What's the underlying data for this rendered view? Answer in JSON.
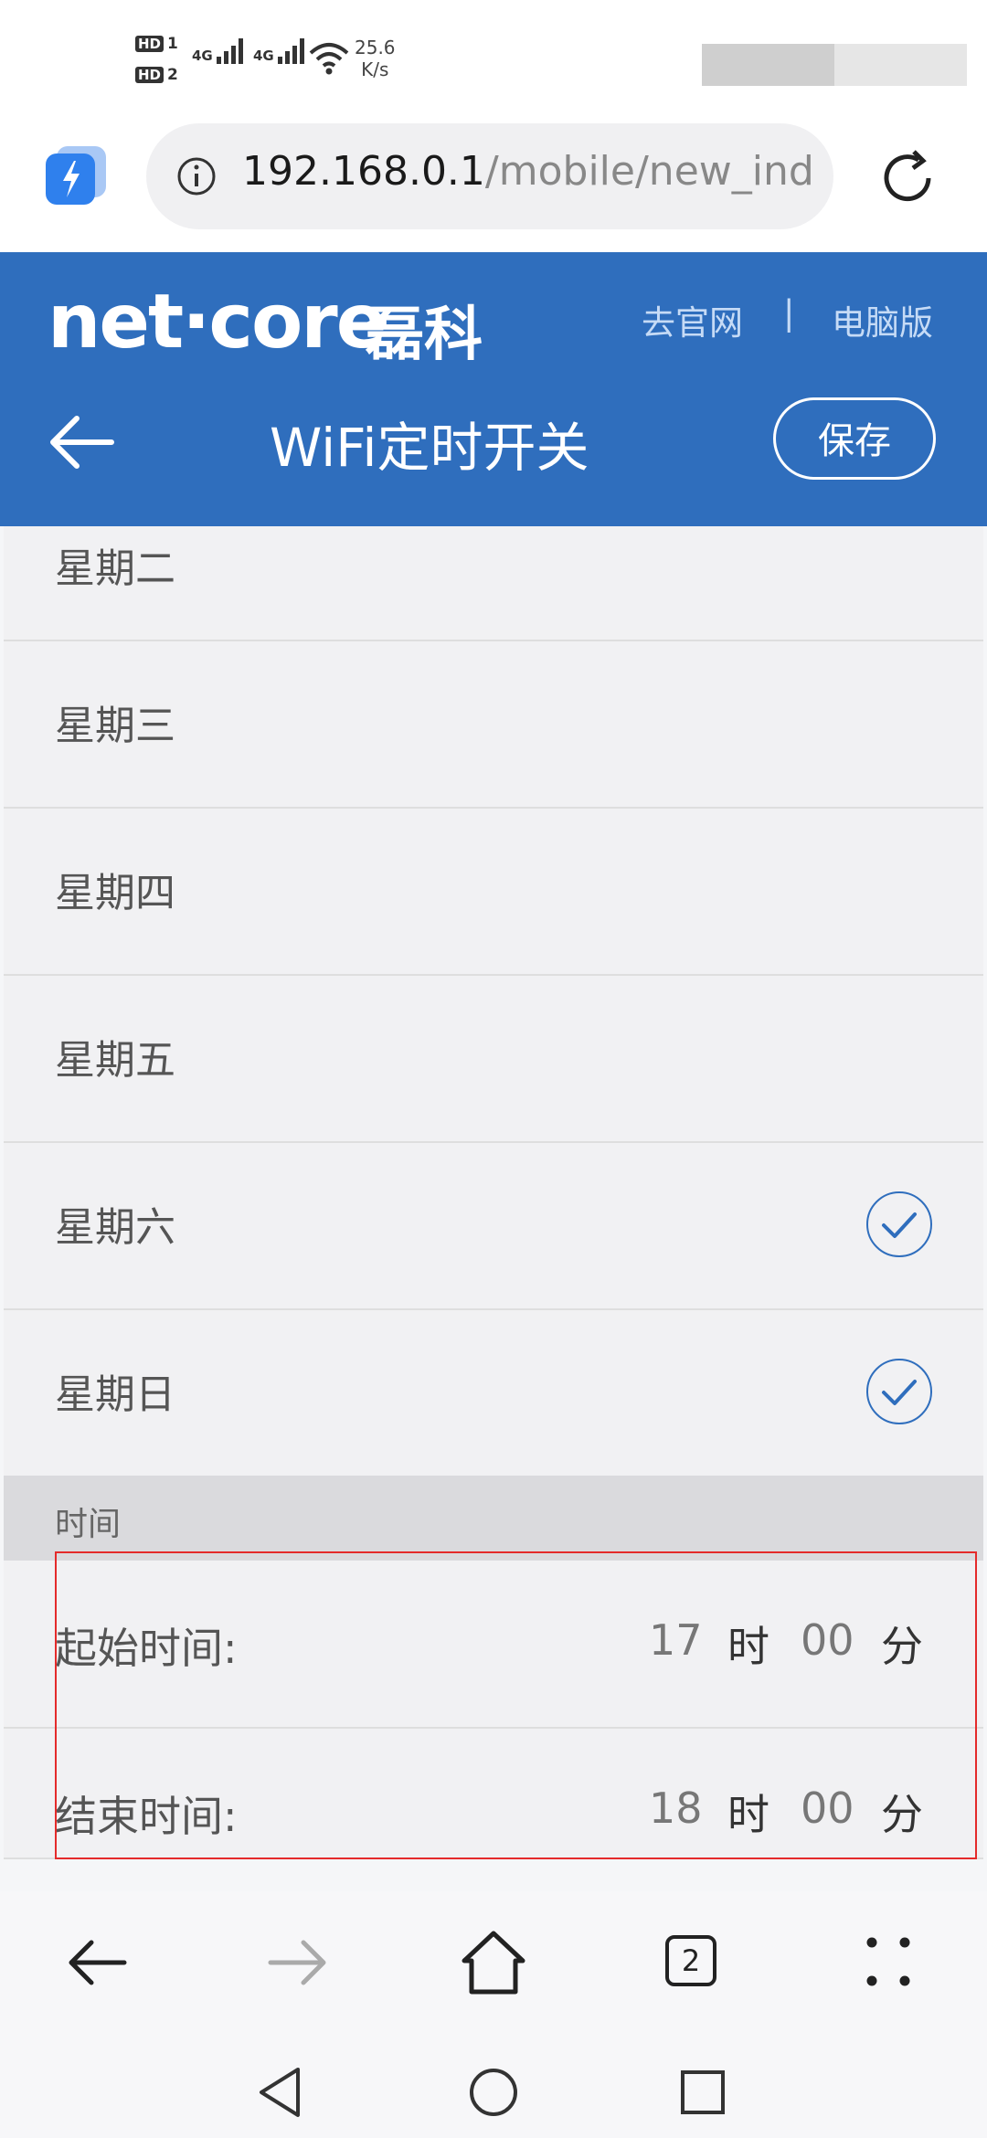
{
  "status_bar": {
    "hd_labels": [
      "HD",
      "HD"
    ],
    "hd_slots": [
      "1",
      "2"
    ],
    "network_type": [
      "4G",
      "4G"
    ],
    "speed_value": "25.6",
    "speed_unit": "K/s"
  },
  "browser": {
    "url_host": "192.168.0.1",
    "url_path": "/mobile/new_inde",
    "tab_count": "2"
  },
  "header": {
    "logo_text": "net·core",
    "logo_cn": "磊科",
    "link_official": "去官网",
    "separator": "|",
    "link_desktop": "电脑版",
    "title": "WiFi定时开关",
    "save_label": "保存"
  },
  "days": [
    {
      "label": "星期二",
      "checked": false
    },
    {
      "label": "星期三",
      "checked": false
    },
    {
      "label": "星期四",
      "checked": false
    },
    {
      "label": "星期五",
      "checked": false
    },
    {
      "label": "星期六",
      "checked": true
    },
    {
      "label": "星期日",
      "checked": true
    }
  ],
  "time_section": {
    "title": "时间",
    "start": {
      "label": "起始时间:",
      "hour": "17",
      "hour_unit": "时",
      "minute": "00",
      "minute_unit": "分"
    },
    "end": {
      "label": "结束时间:",
      "hour": "18",
      "hour_unit": "时",
      "minute": "00",
      "minute_unit": "分"
    }
  },
  "colors": {
    "header_bg": "#2f6ebd",
    "check_color": "#2f6ebd",
    "highlight": "#e42b2b"
  },
  "icons": {
    "browser_logo": "lightning-icon",
    "info": "info-icon",
    "reload": "reload-icon",
    "back": "arrow-left-icon",
    "forward": "arrow-right-icon",
    "home": "home-icon",
    "menu": "dots-icon"
  }
}
